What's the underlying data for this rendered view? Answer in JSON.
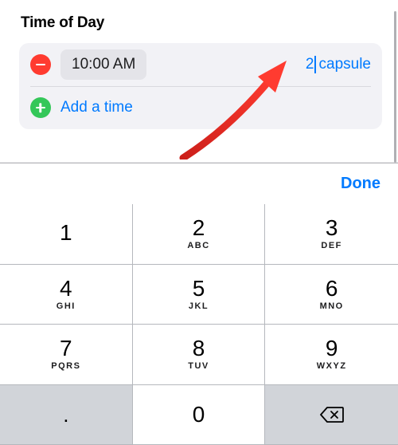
{
  "colors": {
    "accent": "#007aff",
    "destructive": "#ff3b30",
    "success": "#34c759"
  },
  "section": {
    "title": "Time of Day"
  },
  "entries": [
    {
      "time": "10:00 AM",
      "quantity_value": "2",
      "quantity_unit": "capsule"
    }
  ],
  "add_time": {
    "label": "Add a time"
  },
  "keyboard": {
    "done_label": "Done",
    "keys": [
      {
        "digit": "1",
        "letters": ""
      },
      {
        "digit": "2",
        "letters": "ABC"
      },
      {
        "digit": "3",
        "letters": "DEF"
      },
      {
        "digit": "4",
        "letters": "GHI"
      },
      {
        "digit": "5",
        "letters": "JKL"
      },
      {
        "digit": "6",
        "letters": "MNO"
      },
      {
        "digit": "7",
        "letters": "PQRS"
      },
      {
        "digit": "8",
        "letters": "TUV"
      },
      {
        "digit": "9",
        "letters": "WXYZ"
      },
      {
        "digit": ".",
        "letters": ""
      },
      {
        "digit": "0",
        "letters": ""
      },
      {
        "digit": "",
        "letters": ""
      }
    ]
  }
}
